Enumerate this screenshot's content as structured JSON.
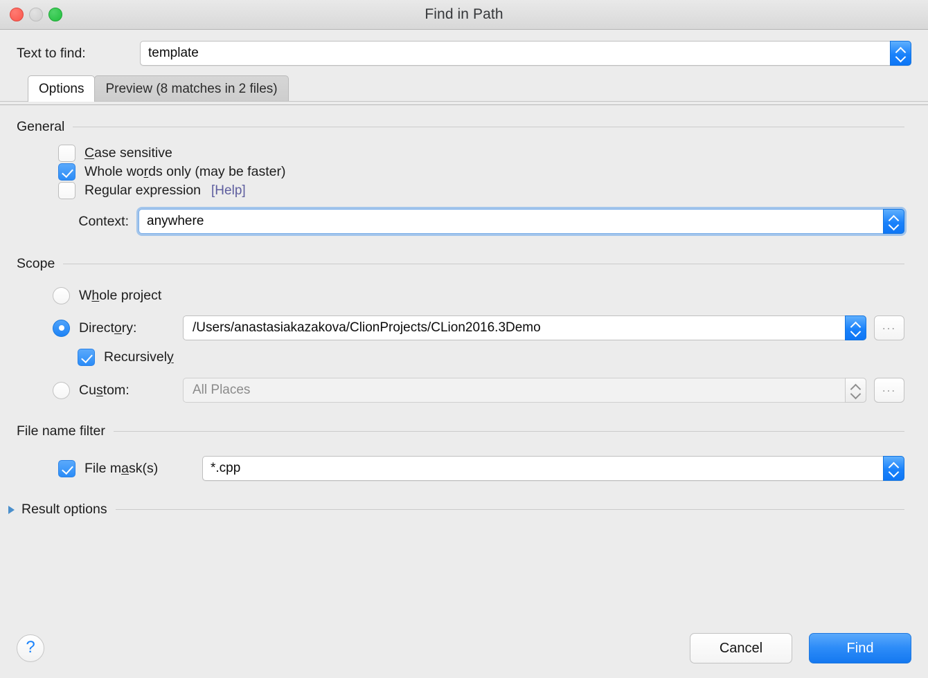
{
  "window": {
    "title": "Find in Path",
    "traffic_lights": [
      "close-button",
      "minimize-button",
      "zoom-button"
    ]
  },
  "search": {
    "label": "Text to find:",
    "value": "template",
    "placeholder": ""
  },
  "tabs": [
    {
      "label": "Options",
      "active": true
    },
    {
      "label": "Preview (8 matches in 2 files)",
      "active": false
    }
  ],
  "general": {
    "heading": "General",
    "options": [
      {
        "label_pre": "",
        "label_mnem": "C",
        "label_post": "ase sensitive",
        "checked": false
      },
      {
        "label_pre": "Whole wo",
        "label_mnem": "r",
        "label_post": "ds only (may be faster)",
        "checked": true
      },
      {
        "label_pre": "Re",
        "label_mnem": "g",
        "label_post": "ular expression",
        "checked": false,
        "link": "[Help]"
      }
    ],
    "context": {
      "label": "Context:",
      "value": "anywhere",
      "focused": true
    }
  },
  "scope": {
    "heading": "Scope",
    "whole_project": {
      "label_pre": "W",
      "label_mnem": "h",
      "label_post": "ole project",
      "selected": false
    },
    "directory": {
      "label_pre": "Direct",
      "label_mnem": "o",
      "label_post": "ry:",
      "selected": true,
      "path": "/Users/anastasiakazakova/ClionProjects/CLion2016.3Demo",
      "browse_label": "...",
      "recursively": {
        "label_pre": "Recursivel",
        "label_mnem": "y",
        "label_post": "",
        "checked": true
      }
    },
    "custom": {
      "label_pre": "Cu",
      "label_mnem": "s",
      "label_post": "tom:",
      "selected": false,
      "value": "All Places",
      "disabled": true,
      "browse_label": "..."
    }
  },
  "file_filter": {
    "heading": "File name filter",
    "mask": {
      "label_pre": "File m",
      "label_mnem": "a",
      "label_post": "sk(s)",
      "checked": true,
      "value": "*.cpp"
    }
  },
  "result_options": {
    "label": "Result options",
    "expanded": false
  },
  "footer": {
    "help_glyph": "?",
    "cancel_label": "Cancel",
    "find_label": "Find"
  },
  "colors": {
    "accent_blue": "#2b8cf7",
    "window_bg": "#ececec",
    "link": "#5d5d9e",
    "disclosure": "#4a8fcc"
  }
}
